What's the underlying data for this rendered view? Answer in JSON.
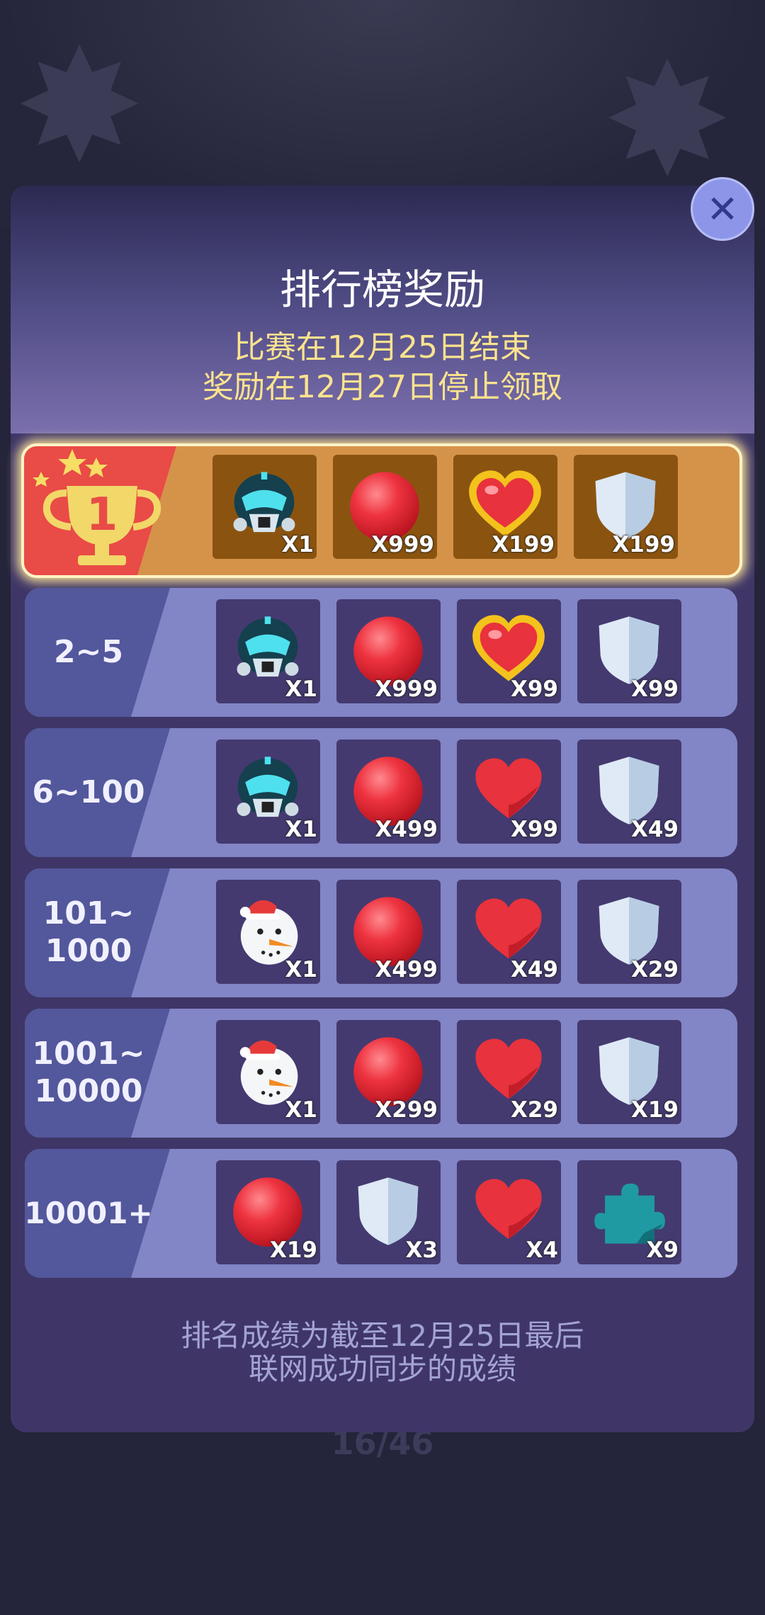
{
  "background": {
    "page_indicator": "16/46"
  },
  "header": {
    "title": "排行榜奖励",
    "subtitle_line1": "比赛在12月25日结束",
    "subtitle_line2": "奖励在12月27日停止领取"
  },
  "close_label": "✕",
  "rows": [
    {
      "rank": "1",
      "rewards": [
        {
          "icon": "robot-mask-icon",
          "qty": "X1"
        },
        {
          "icon": "red-ball-icon",
          "qty": "X999"
        },
        {
          "icon": "gold-heart-icon",
          "qty": "X199"
        },
        {
          "icon": "shield-icon",
          "qty": "X199"
        }
      ]
    },
    {
      "rank": "2~5",
      "rewards": [
        {
          "icon": "robot-mask-icon",
          "qty": "X1"
        },
        {
          "icon": "red-ball-icon",
          "qty": "X999"
        },
        {
          "icon": "gold-heart-icon",
          "qty": "X99"
        },
        {
          "icon": "shield-icon",
          "qty": "X99"
        }
      ]
    },
    {
      "rank": "6~100",
      "rewards": [
        {
          "icon": "robot-mask-icon",
          "qty": "X1"
        },
        {
          "icon": "red-ball-icon",
          "qty": "X499"
        },
        {
          "icon": "heart-icon",
          "qty": "X99"
        },
        {
          "icon": "shield-icon",
          "qty": "X49"
        }
      ]
    },
    {
      "rank": "101~\n1000",
      "rewards": [
        {
          "icon": "snowman-icon",
          "qty": "X1"
        },
        {
          "icon": "red-ball-icon",
          "qty": "X499"
        },
        {
          "icon": "heart-icon",
          "qty": "X49"
        },
        {
          "icon": "shield-icon",
          "qty": "X29"
        }
      ]
    },
    {
      "rank": "1001~\n10000",
      "rewards": [
        {
          "icon": "snowman-icon",
          "qty": "X1"
        },
        {
          "icon": "red-ball-icon",
          "qty": "X299"
        },
        {
          "icon": "heart-icon",
          "qty": "X29"
        },
        {
          "icon": "shield-icon",
          "qty": "X19"
        }
      ]
    },
    {
      "rank": "10001+",
      "rewards": [
        {
          "icon": "red-ball-icon",
          "qty": "X19"
        },
        {
          "icon": "shield-icon",
          "qty": "X3"
        },
        {
          "icon": "heart-icon",
          "qty": "X4"
        },
        {
          "icon": "puzzle-icon",
          "qty": "X9"
        }
      ]
    }
  ],
  "footer": {
    "line1": "排名成绩为截至12月25日最后",
    "line2": "联网成功同步的成绩"
  },
  "colors": {
    "panel": "#3f3667",
    "row": "#8285c6",
    "first_row": "#d5934a",
    "accent_yellow": "#fde38e",
    "reward_red": "#e8323d"
  }
}
